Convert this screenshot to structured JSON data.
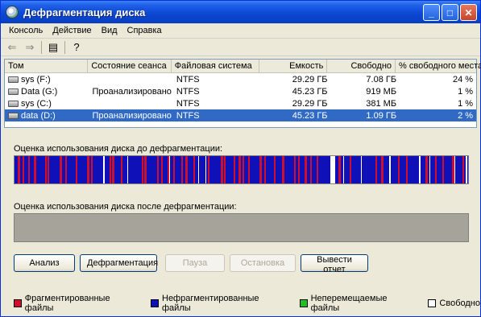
{
  "window": {
    "title": "Дефрагментация диска"
  },
  "menu": [
    {
      "label": "Консоль"
    },
    {
      "label": "Действие"
    },
    {
      "label": "Вид"
    },
    {
      "label": "Справка"
    }
  ],
  "toolbar": {
    "icons": [
      "back-arrow-icon",
      "forward-arrow-icon",
      "console-tree-icon",
      "help-icon"
    ]
  },
  "volumes": {
    "headers": [
      "Том",
      "Состояние сеанса",
      "Файловая система",
      "Емкость",
      "Свободно",
      "% свободного места"
    ],
    "rows": [
      {
        "name": "sys (F:)",
        "state": "",
        "fs": "NTFS",
        "capacity": "29.29 ГБ",
        "free": "7.08 ГБ",
        "pct": "24 %"
      },
      {
        "name": "Data (G:)",
        "state": "Проанализировано",
        "fs": "NTFS",
        "capacity": "45.23 ГБ",
        "free": "919 МБ",
        "pct": "1 %"
      },
      {
        "name": "sys (C:)",
        "state": "",
        "fs": "NTFS",
        "capacity": "29.29 ГБ",
        "free": "381 МБ",
        "pct": "1 %"
      },
      {
        "name": "data (D:)",
        "state": "Проанализировано",
        "fs": "NTFS",
        "capacity": "45.23 ГБ",
        "free": "1.09 ГБ",
        "pct": "2 %",
        "selected": true
      }
    ]
  },
  "analysis": {
    "before_label": "Оценка использования диска до дефрагментации:",
    "after_label": "Оценка использования диска после дефрагментации:"
  },
  "buttons": {
    "analyze": "Анализ",
    "defrag": "Дефрагментация",
    "pause": "Пауза",
    "stop": "Остановка",
    "report": "Вывести отчет"
  },
  "legend": {
    "fragmented": "Фрагментированные файлы",
    "contiguous": "Нефрагментированные файлы",
    "unmovable": "Неперемещаемые файлы",
    "free": "Свободно"
  },
  "colors": {
    "fragmented": "#d0102a",
    "contiguous": "#1010b8",
    "unmovable": "#20c020",
    "free": "#ffffff"
  }
}
